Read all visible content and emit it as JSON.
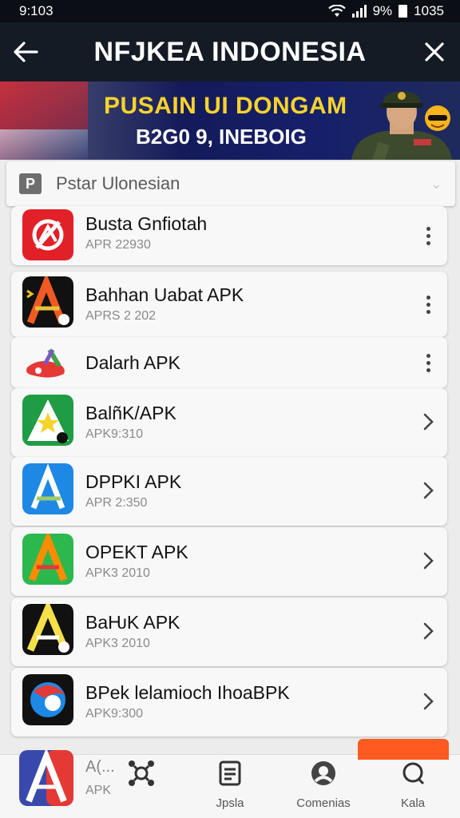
{
  "status_bar": {
    "time": "9:103",
    "battery": "9%",
    "extra": "1035"
  },
  "app_bar": {
    "title": "NFJKEA INDONESIA"
  },
  "banner": {
    "line1": "PUSAIN UI DONGAM",
    "line2": "B2G0 9, INEBOIG"
  },
  "search": {
    "placeholder": "Pstar Ulonesian",
    "icon_letter": "P"
  },
  "apps": [
    {
      "name": "Busta Gnfiotah",
      "meta": "APR 22930",
      "action": "more",
      "icon": "red-circle-logo-icon"
    },
    {
      "name": "Bahhan Uabat APK",
      "meta": "APRS 2 202",
      "action": "more",
      "icon": "dark-a-logo-icon"
    },
    {
      "name": "Dalarh APK",
      "meta": "",
      "action": "more",
      "icon": "red-green-logo-icon"
    },
    {
      "name": "BalñK/APK",
      "meta": "APK9:310",
      "action": "open",
      "icon": "green-star-logo-icon"
    },
    {
      "name": "DPPKI APK",
      "meta": "APR 2:350",
      "action": "open",
      "icon": "blue-a-logo-icon"
    },
    {
      "name": "OPEKT APK",
      "meta": "APK3 2010",
      "action": "open",
      "icon": "green-a-logo-icon"
    },
    {
      "name": "BaǶK APK",
      "meta": "APK3 2010",
      "action": "open",
      "icon": "black-a-logo-icon"
    },
    {
      "name": "BPek lelamioch IhoaBPK",
      "meta": "APK9:300",
      "action": "open",
      "icon": "orbit-logo-icon"
    }
  ],
  "partial_row": {
    "name": "A(... ",
    "meta": "APK"
  },
  "bottom_nav": [
    {
      "label": "",
      "icon": "share-icon"
    },
    {
      "label": "Jpsla",
      "icon": "list-icon"
    },
    {
      "label": "Comenias",
      "icon": "community-icon"
    },
    {
      "label": "Kala",
      "icon": "chat-icon"
    }
  ],
  "colors": {
    "app_bar": "#151b25",
    "banner_title": "#f6d32c",
    "accent_orange": "#ff5a1f"
  }
}
